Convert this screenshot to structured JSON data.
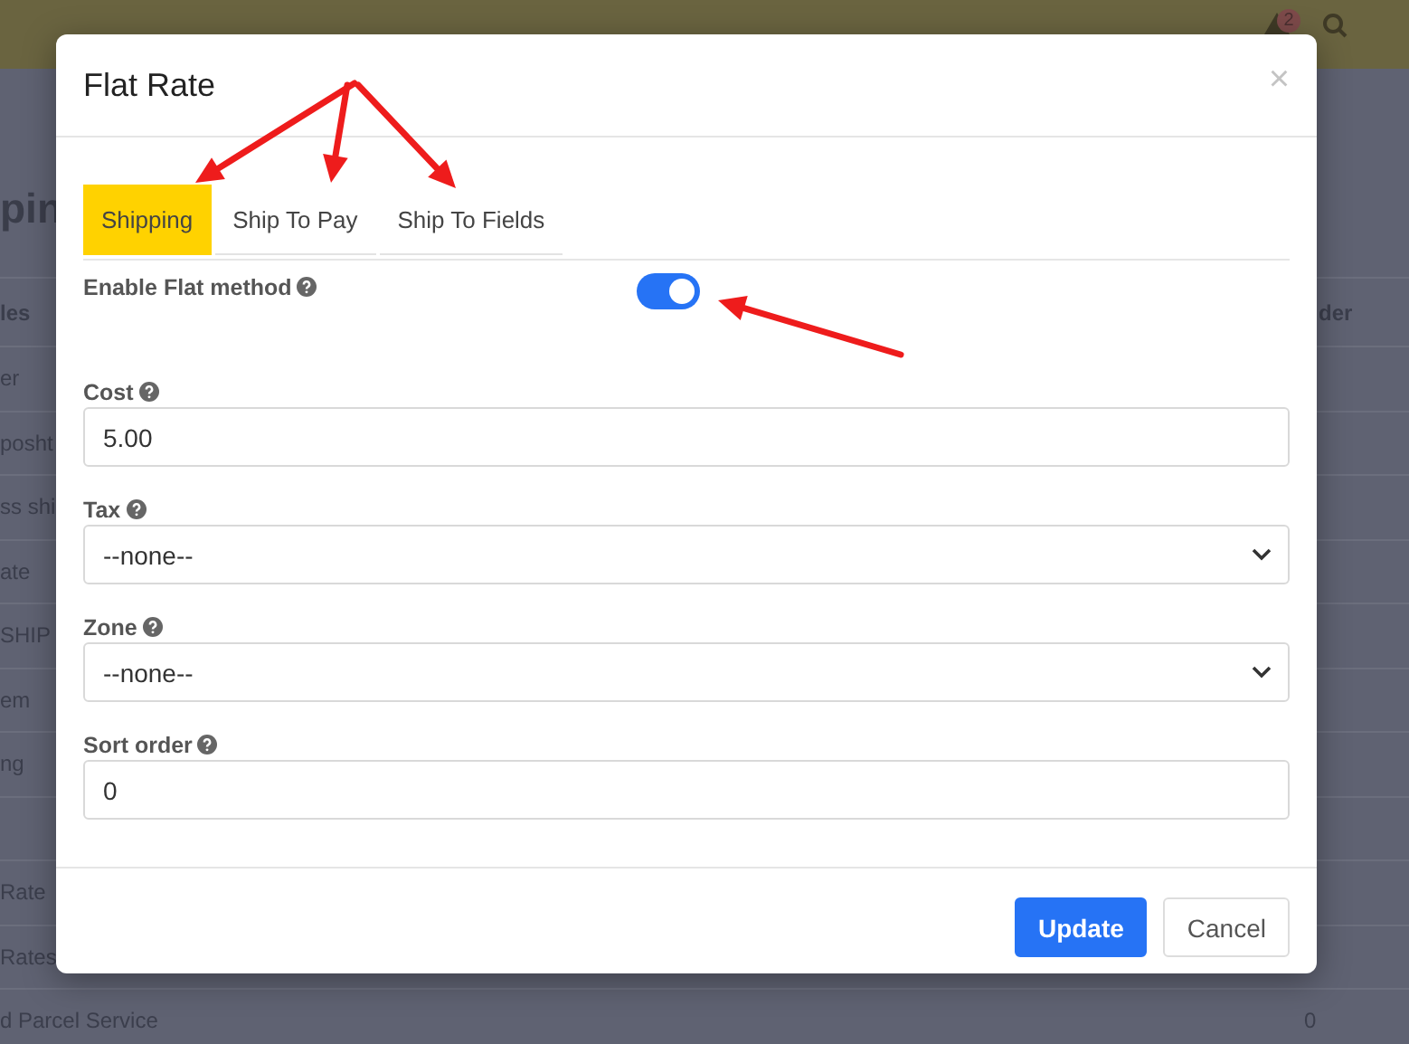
{
  "top_bar": {
    "alert_badge": "2"
  },
  "background_page": {
    "heading": "pin",
    "header": {
      "column_1": "les",
      "column_2": "der"
    },
    "sections": [
      [
        {
          "column_1": "er"
        },
        {
          "column_1": "posht"
        },
        {
          "column_1": "ss shi"
        },
        {
          "column_1": "ate"
        },
        {
          "column_1": "SHIP"
        },
        {
          "column_1": "em"
        },
        {
          "column_1": "ng"
        }
      ],
      [
        {
          "column_1": "Rate"
        },
        {
          "column_1": "Rates"
        },
        {
          "column_1": "d Parcel Service",
          "column_2": "0"
        }
      ]
    ]
  },
  "modal": {
    "title": "Flat Rate",
    "close": "×",
    "tabs": [
      {
        "label": "Shipping",
        "selected": true
      },
      {
        "label": "Ship To Pay",
        "selected": false
      },
      {
        "label": "Ship To Fields",
        "selected": false
      }
    ],
    "enable": {
      "label": "Enable Flat method",
      "on": true
    },
    "fields": [
      {
        "label": "Cost",
        "kind": "text",
        "value": "5.00"
      },
      {
        "label": "Tax",
        "kind": "select",
        "value": "--none--"
      },
      {
        "label": "Zone",
        "kind": "select",
        "value": "--none--"
      },
      {
        "label": "Sort order",
        "kind": "text",
        "value": "0"
      }
    ],
    "buttons": [
      {
        "label": "Update",
        "kind": "primary"
      },
      {
        "label": "Cancel",
        "kind": "secondary"
      }
    ]
  }
}
